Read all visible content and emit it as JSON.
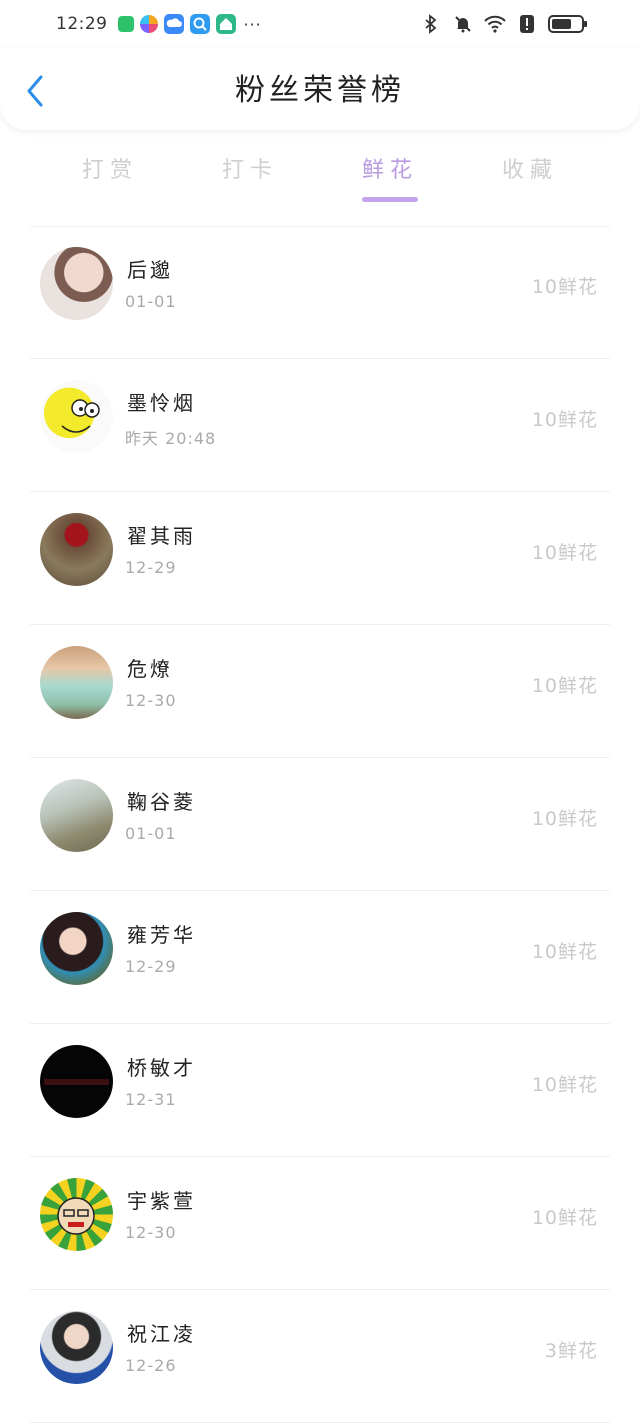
{
  "status_bar": {
    "time": "12:29",
    "more": "···",
    "icons": [
      "app-green-icon",
      "app-multicolor-icon",
      "cloud-app-icon",
      "search-app-icon",
      "home-app-icon",
      "bluetooth-icon",
      "mute-icon",
      "wifi-icon",
      "alert-icon",
      "battery-icon"
    ]
  },
  "header": {
    "title": "粉丝荣誉榜",
    "back_icon": "chevron-left-icon",
    "accent_color": "#2b8de8"
  },
  "tabs": [
    {
      "label": "打赏",
      "active": false
    },
    {
      "label": "打卡",
      "active": false
    },
    {
      "label": "鲜花",
      "active": true
    },
    {
      "label": "收藏",
      "active": false
    }
  ],
  "active_tab_color": "#b99be0",
  "list": [
    {
      "name": "后邈",
      "time": "01-01",
      "amount": "10鲜花"
    },
    {
      "name": "墨怜烟",
      "time": "昨天 20:48",
      "amount": "10鲜花"
    },
    {
      "name": "翟其雨",
      "time": "12-29",
      "amount": "10鲜花"
    },
    {
      "name": "危燎",
      "time": "12-30",
      "amount": "10鲜花"
    },
    {
      "name": "鞠谷菱",
      "time": "01-01",
      "amount": "10鲜花"
    },
    {
      "name": "雍芳华",
      "time": "12-29",
      "amount": "10鲜花"
    },
    {
      "name": "桥敏才",
      "time": "12-31",
      "amount": "10鲜花"
    },
    {
      "name": "宇紫萱",
      "time": "12-30",
      "amount": "10鲜花"
    },
    {
      "name": "祝江凌",
      "time": "12-26",
      "amount": "3鲜花"
    }
  ]
}
